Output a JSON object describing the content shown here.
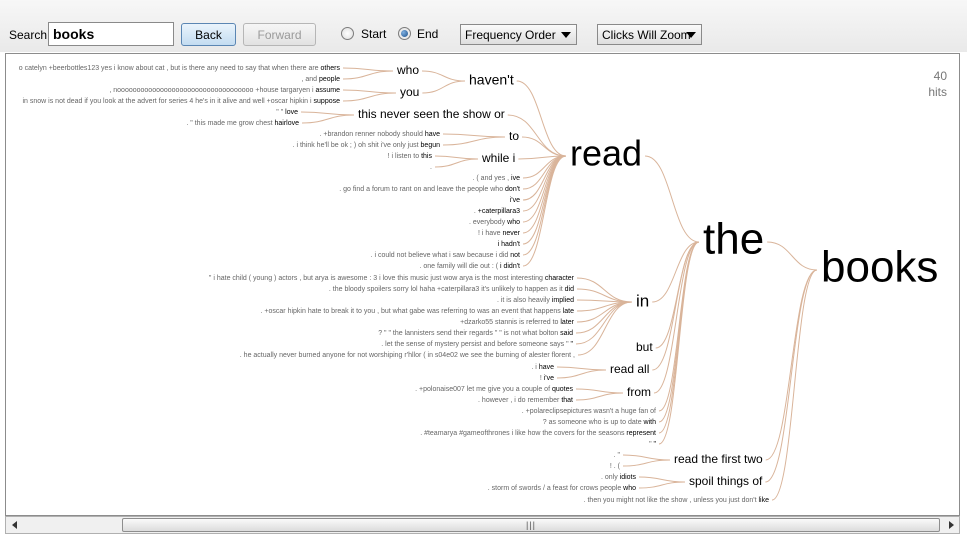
{
  "toolbar": {
    "search_label": "Search",
    "search_value": "books",
    "back_label": "Back",
    "forward_label": "Forward",
    "start_label": "Start",
    "end_label": "End",
    "selected_radio": "End",
    "order_select": "Frequency Order",
    "zoom_select": "Clicks Will Zoom"
  },
  "hits": {
    "count": "40",
    "unit": "hits"
  },
  "scrollbar": {
    "thumb_grip": "|||"
  },
  "colors": {
    "branch": "#d9b49a",
    "big_text": "#000000",
    "context_text": "#666666",
    "keyword_text": "#000000"
  },
  "tree": {
    "root": "books",
    "level1": [
      "the",
      "spoil things of",
      "read the first two"
    ],
    "level2": [
      "read",
      "in",
      "but",
      "read all",
      "from"
    ],
    "level3": [
      "haven't",
      "this never seen the show or",
      "to",
      "while i",
      "who",
      "you"
    ],
    "contexts": [
      {
        "pre": "o catelyn +beerbottles123 yes i know about cat , but is there any need to say that when there are",
        "kw": "others"
      },
      {
        "pre": ", and",
        "kw": "people"
      },
      {
        "pre": ", nooooooooooooooooooooooooooooooooooo +house targaryen i",
        "kw": "assume"
      },
      {
        "pre": "in snow is not dead if you look at the advert for series 4 he's in it alive and well +oscar hipkin i",
        "kw": "suppose"
      },
      {
        "pre": "\" \"",
        "kw": "love"
      },
      {
        "pre": ". \" this made me grow chest",
        "kw": "hairlove"
      },
      {
        "pre": ". +brandon renner nobody should",
        "kw": "have"
      },
      {
        "pre": ". i think he'll be ok ; ) oh shit i've only just",
        "kw": "begun"
      },
      {
        "pre": "! i listen to",
        "kw": "this"
      },
      {
        "pre": ".",
        "kw": ""
      },
      {
        "pre": ". ( and yes ,",
        "kw": "ive"
      },
      {
        "pre": ". go find a forum to rant on and leave the people who",
        "kw": "don't"
      },
      {
        "pre": "",
        "kw": "i've"
      },
      {
        "pre": ".",
        "kw": "+caterpillara3"
      },
      {
        "pre": ". everybody",
        "kw": "who"
      },
      {
        "pre": "! i have",
        "kw": "never"
      },
      {
        "pre": "",
        "kw": "i hadn't"
      },
      {
        "pre": ". i could not believe what i saw because i did",
        "kw": "not"
      },
      {
        "pre": ". one family will die out : (",
        "kw": "i didn't"
      },
      {
        "pre": "\" i hate child ( young ) actors , but arya is awesome : 3 i love this music just wow arya is the most interesting",
        "kw": "character"
      },
      {
        "pre": ". the bloody spoilers sorry lol haha +caterpillara3 it's unlikely to happen as it",
        "kw": "did"
      },
      {
        "pre": ". it is also heavily",
        "kw": "implied"
      },
      {
        "pre": ". +oscar hipkin hate to break it to you , but what gabe was referring to was an event that happens",
        "kw": "late"
      },
      {
        "pre": "+dzarko55 stannis is referred to",
        "kw": "later"
      },
      {
        "pre": "? \" \" the lannisters send their regards \" \" is not what bolton",
        "kw": "said"
      },
      {
        "pre": ". let the sense of mystery persist and before someone says \"",
        "kw": "\""
      },
      {
        "pre": ". he actually never burned anyone for not worshiping r'hllor ( in s04e02 we see the burning of alester florent ,",
        "kw": ""
      },
      {
        "pre": ". i",
        "kw": "have"
      },
      {
        "pre": "!",
        "kw": "i've"
      },
      {
        "pre": ". +polonaise007 let me give you a couple of",
        "kw": "quotes"
      },
      {
        "pre": ". however , i do remember",
        "kw": "that"
      },
      {
        "pre": ". +polareclipsepictures wasn't a huge fan of",
        "kw": ""
      },
      {
        "pre": "? as someone who is up to date",
        "kw": "with"
      },
      {
        "pre": ". #teamarya #gameofthrones i like how the covers for the seasons",
        "kw": "represent"
      },
      {
        "pre": "\"",
        "kw": "\""
      },
      {
        "pre": ". \"",
        "kw": ""
      },
      {
        "pre": "! . (",
        "kw": ""
      },
      {
        "pre": ". only",
        "kw": "idiots"
      },
      {
        "pre": ". storm of swords / a feast for crows people",
        "kw": "who"
      },
      {
        "pre": ". then you might not like the show , unless you just don't",
        "kw": "like"
      }
    ]
  }
}
